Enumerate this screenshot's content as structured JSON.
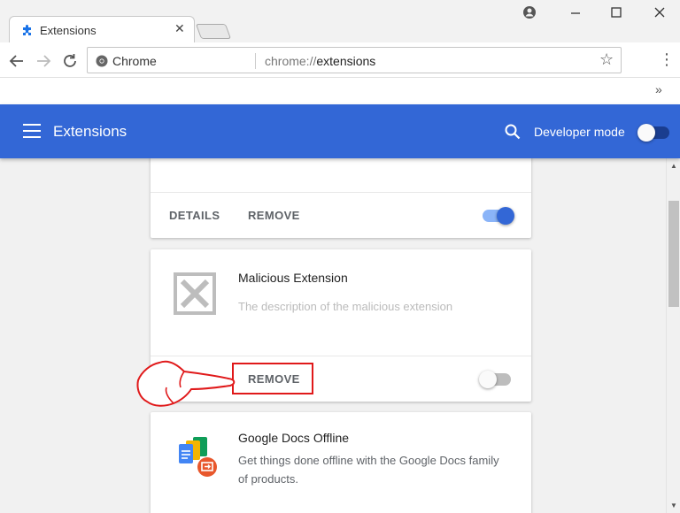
{
  "tab": {
    "title": "Extensions",
    "close": "✕"
  },
  "toolbar": {
    "site_label": "Chrome",
    "url_scheme": "chrome://",
    "url_host": "extensions"
  },
  "bookmarks": {
    "overflow": "»"
  },
  "header": {
    "title": "Extensions",
    "developer_mode_label": "Developer mode",
    "developer_mode_on": false
  },
  "cards": [
    {
      "details_label": "DETAILS",
      "remove_label": "REMOVE",
      "enabled": true
    },
    {
      "name": "Malicious Extension",
      "description": "The description of the malicious extension",
      "remove_label": "REMOVE",
      "enabled": false
    },
    {
      "name": "Google Docs Offline",
      "description": "Get things done offline with the Google Docs family of products."
    }
  ],
  "colors": {
    "appbar": "#3367d6",
    "highlight": "#e0191a",
    "toggle_on": "#3367d6"
  }
}
